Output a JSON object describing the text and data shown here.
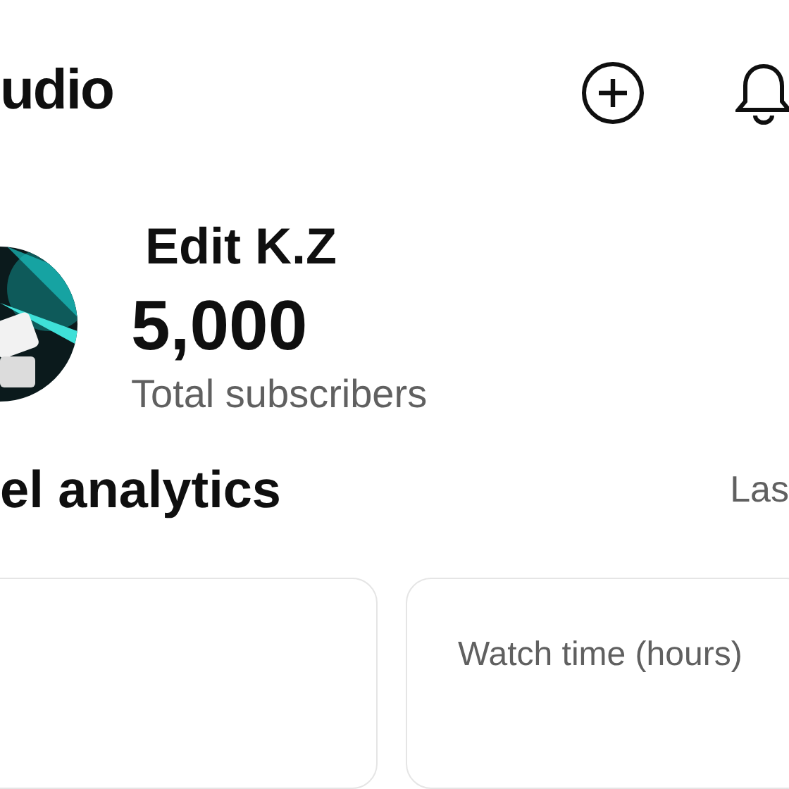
{
  "header": {
    "title": "udio"
  },
  "channel": {
    "name": "Edit K.Z",
    "subscribers": "5,000",
    "subscribers_label": "Total subscribers"
  },
  "analytics": {
    "title": "el analytics",
    "period": "Las"
  },
  "cards": [
    {
      "kind": "blank"
    },
    {
      "kind": "metric",
      "label": "Watch time (hours)"
    }
  ]
}
